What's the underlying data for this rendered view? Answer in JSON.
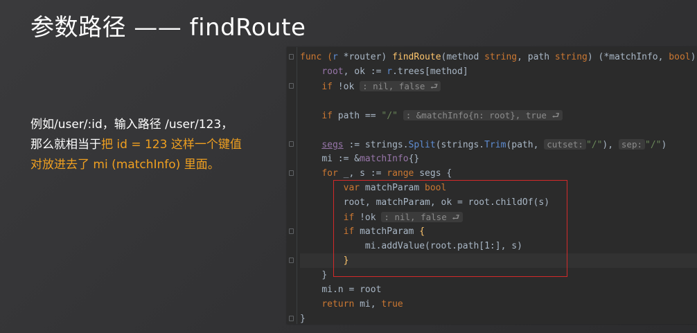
{
  "title": "参数路径 —— findRoute",
  "description": {
    "line1": "例如/user/:id，输入路径 /user/123，",
    "line2_plain": "那么就相当于",
    "line2_highlight": "把 id = 123 这样一个键值",
    "line3_highlight": "对放进去了 mi (matchInfo) 里面。"
  },
  "code": {
    "l1": {
      "a": "func (",
      "b": "r",
      "c": " *router) ",
      "d": "findRoute",
      "e": "(method ",
      "f": "string",
      ".": ", path ",
      "g": "string",
      "h": ") (*matchInfo, ",
      "i": "bool",
      "j": ")"
    },
    "l2": {
      "a": "root",
      "b": ", ok := ",
      "c": "r",
      ".": ".trees[method]"
    },
    "l3": {
      "a": "if",
      " ": " !ok ",
      "hint": ": nil, false ⮐"
    },
    "l5": {
      "a": "if",
      " ": " path == ",
      "s": "\"/\"",
      "hint": ": &matchInfo{n: root}, true ⮐"
    },
    "l7": {
      "a": "segs",
      ".": " := strings.",
      "fn": "Split",
      "b": "(strings.",
      "fn2": "Trim",
      "c": "(path, ",
      "h1": "cutset:",
      "s1": "\"/\"",
      "d": "), ",
      "h2": "sep:",
      "s2": "\"/\"",
      "e": ")"
    },
    "l8": {
      "a": "mi := &",
      "ty": "matchInfo",
      "b": "{}"
    },
    "l9": {
      "k1": "for",
      " ": " _, s := ",
      "k2": "range",
      " 2": " segs {"
    },
    "l10": {
      "k": "var",
      " ": " matchParam ",
      "t": "bool"
    },
    "l11": {
      "a": "root, matchParam, ok = root.childOf(s)"
    },
    "l12": {
      "k": "if",
      " ": " !ok ",
      "hint": ": nil, false ⮐"
    },
    "l13": {
      "k": "if",
      " ": " matchParam ",
      "b": "{"
    },
    "l14": {
      "a": "mi.addValue(root.path[1:], s)"
    },
    "l15": {
      "a": "}"
    },
    "l16": {
      "a": "}"
    },
    "l17": {
      "a": "mi.n = root"
    },
    "l18": {
      "k": "return",
      " ": " mi, ",
      "t": "true"
    },
    "l19": {
      "a": "}"
    }
  },
  "colors": {
    "highlight_text": "#f0a020",
    "highlight_box": "#d42a2a",
    "editor_bg": "#2b2b2b"
  }
}
